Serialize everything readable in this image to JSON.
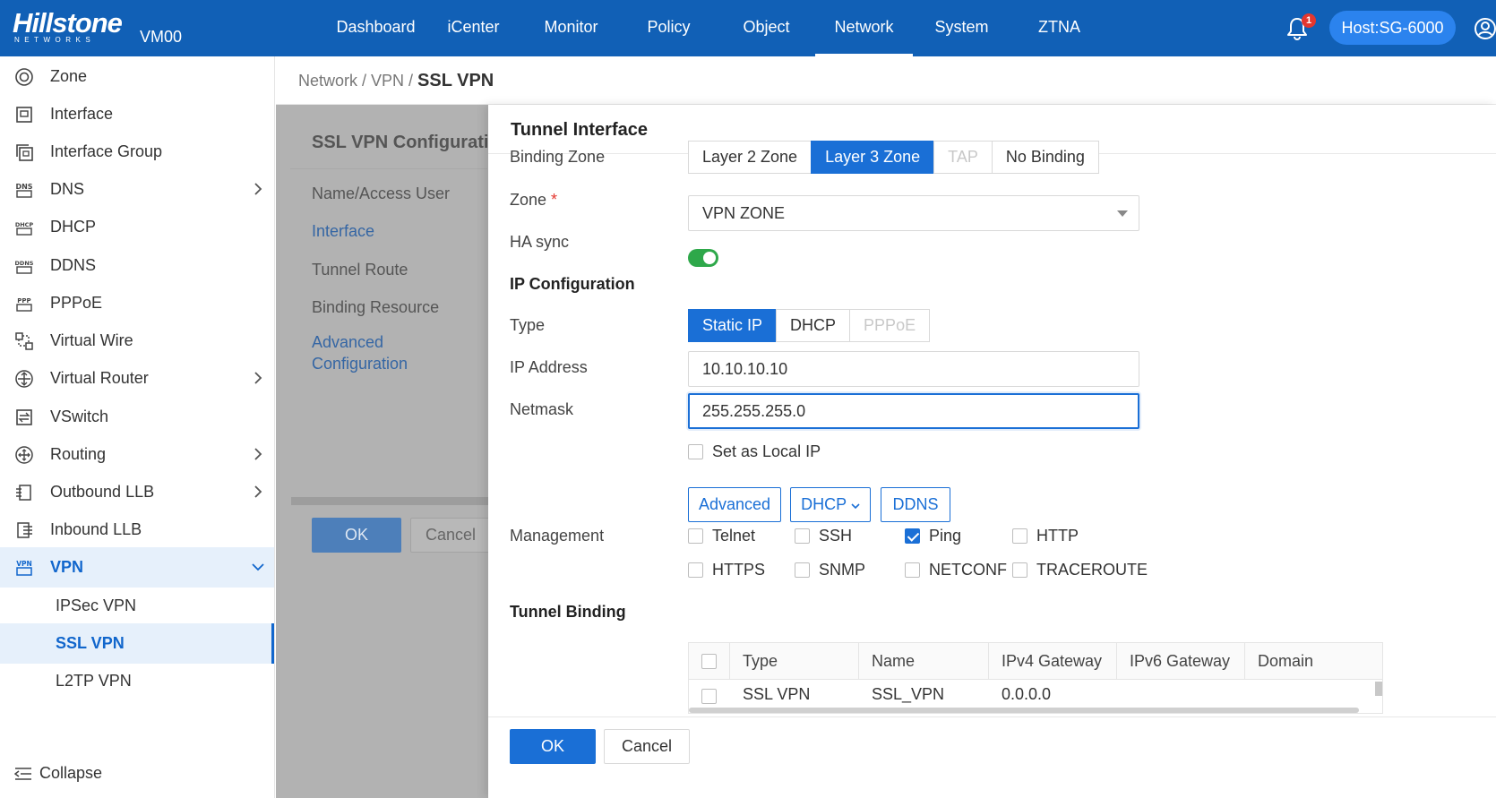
{
  "header": {
    "brand": "Hillstone",
    "brand_sub": "NETWORKS",
    "device": "VM00",
    "nav": [
      "Dashboard",
      "iCenter",
      "Monitor",
      "Policy",
      "Object",
      "Network",
      "System",
      "ZTNA"
    ],
    "active_nav": "Network",
    "notifications": "1",
    "host": "Host:SG-6000"
  },
  "sidebar": {
    "items": [
      {
        "label": "Zone",
        "icon": "zone-icon"
      },
      {
        "label": "Interface",
        "icon": "interface-icon"
      },
      {
        "label": "Interface Group",
        "icon": "interface-group-icon"
      },
      {
        "label": "DNS",
        "icon": "dns-icon"
      },
      {
        "label": "DHCP",
        "icon": "dhcp-icon"
      },
      {
        "label": "DDNS",
        "icon": "ddns-icon"
      },
      {
        "label": "PPPoE",
        "icon": "pppoe-icon"
      },
      {
        "label": "Virtual Wire",
        "icon": "virtual-wire-icon"
      },
      {
        "label": "Virtual Router",
        "icon": "virtual-router-icon"
      },
      {
        "label": "VSwitch",
        "icon": "vswitch-icon"
      },
      {
        "label": "Routing",
        "icon": "routing-icon"
      },
      {
        "label": "Outbound LLB",
        "icon": "outbound-llb-icon"
      },
      {
        "label": "Inbound LLB",
        "icon": "inbound-llb-icon"
      },
      {
        "label": "VPN",
        "icon": "vpn-icon"
      }
    ],
    "vpn_sub": [
      "IPSec VPN",
      "SSL VPN",
      "L2TP VPN"
    ],
    "active_sub": "SSL VPN",
    "collapse": "Collapse"
  },
  "breadcrumb": {
    "path": "Network / VPN / ",
    "current": "SSL VPN"
  },
  "background_page": {
    "title": "SSL VPN Configurati",
    "nav": [
      "Name/Access User",
      "Interface",
      "Tunnel Route",
      "Binding Resource",
      "Advanced",
      "Configuration"
    ],
    "ok": "OK",
    "cancel": "Cancel"
  },
  "drawer": {
    "title": "Tunnel Interface",
    "binding_zone": {
      "label": "Binding Zone",
      "options": [
        "Layer 2 Zone",
        "Layer 3 Zone",
        "TAP",
        "No Binding"
      ],
      "selected": "Layer 3 Zone"
    },
    "zone": {
      "label": "Zone",
      "required": "*",
      "value": "VPN ZONE"
    },
    "ha_sync": {
      "label": "HA sync",
      "on": true
    },
    "ip_config_title": "IP Configuration",
    "type": {
      "label": "Type",
      "options": [
        "Static IP",
        "DHCP",
        "PPPoE"
      ],
      "selected": "Static IP"
    },
    "ip_address": {
      "label": "IP Address",
      "value": "10.10.10.10"
    },
    "netmask": {
      "label": "Netmask",
      "value": "255.255.255.0"
    },
    "local_ip": {
      "label": "Set as Local IP",
      "checked": false
    },
    "buttons": {
      "advanced": "Advanced",
      "dhcp": "DHCP",
      "ddns": "DDNS"
    },
    "management": {
      "label": "Management",
      "options": [
        {
          "label": "Telnet",
          "checked": false
        },
        {
          "label": "SSH",
          "checked": false
        },
        {
          "label": "Ping",
          "checked": true
        },
        {
          "label": "HTTP",
          "checked": false
        },
        {
          "label": "HTTPS",
          "checked": false
        },
        {
          "label": "SNMP",
          "checked": false
        },
        {
          "label": "NETCONF",
          "checked": false
        },
        {
          "label": "TRACEROUTE",
          "checked": false
        }
      ]
    },
    "tunnel_binding": {
      "title": "Tunnel Binding",
      "columns": [
        "Type",
        "Name",
        "IPv4 Gateway",
        "IPv6 Gateway",
        "Domain"
      ],
      "rows": [
        {
          "type": "SSL VPN",
          "name": "SSL_VPN",
          "ipv4": "0.0.0.0",
          "ipv6": "",
          "domain": ""
        }
      ]
    },
    "ok": "OK",
    "cancel": "Cancel"
  },
  "colors": {
    "header_bg": "#1160b6",
    "primary": "#1a6fd6",
    "toggle_on": "#2ea84a",
    "badge": "#e4372f"
  }
}
